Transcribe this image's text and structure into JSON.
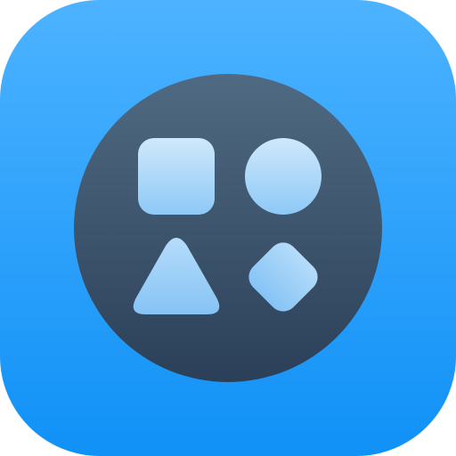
{
  "app_icon": {
    "name": "shapes-app-icon",
    "colors": {
      "background_top": "#4db3ff",
      "background_bottom": "#1091f7",
      "disc_top": "#4f6a82",
      "disc_bottom": "#2b4058",
      "glyph_top": "#cfe8fb",
      "glyph_bottom": "#8ec9f7"
    },
    "glyphs": [
      "rounded-square-icon",
      "circle-icon",
      "triangle-icon",
      "diamond-icon"
    ]
  }
}
